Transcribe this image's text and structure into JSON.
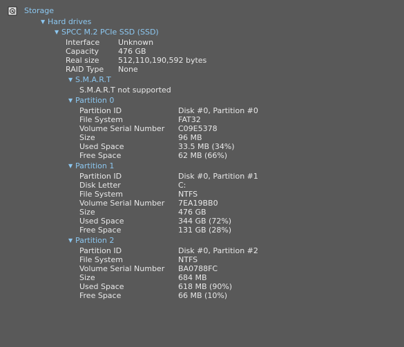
{
  "tree": {
    "root_label": "Storage",
    "hard_drives_label": "Hard drives",
    "drive_label": "SPCC M.2 PCIe SSD (SSD)",
    "drive_props": [
      {
        "key": "Interface",
        "value": "Unknown"
      },
      {
        "key": "Capacity",
        "value": "476 GB"
      },
      {
        "key": "Real size",
        "value": "512,110,190,592 bytes"
      },
      {
        "key": "RAID Type",
        "value": "None"
      }
    ],
    "smart_label": "S.M.A.R.T",
    "smart_status": "S.M.A.R.T not supported",
    "partitions": [
      {
        "label": "Partition 0",
        "props": [
          {
            "key": "Partition ID",
            "value": "Disk #0, Partition #0"
          },
          {
            "key": "File System",
            "value": "FAT32"
          },
          {
            "key": "Volume Serial Number",
            "value": "C09E5378"
          },
          {
            "key": "Size",
            "value": "96 MB"
          },
          {
            "key": "Used Space",
            "value": "33.5 MB (34%)"
          },
          {
            "key": "Free Space",
            "value": "62 MB (66%)"
          }
        ]
      },
      {
        "label": "Partition 1",
        "props": [
          {
            "key": "Partition ID",
            "value": "Disk #0, Partition #1"
          },
          {
            "key": "Disk Letter",
            "value": "C:"
          },
          {
            "key": "File System",
            "value": "NTFS"
          },
          {
            "key": "Volume Serial Number",
            "value": "7EA19BB0"
          },
          {
            "key": "Size",
            "value": "476 GB"
          },
          {
            "key": "Used Space",
            "value": "344 GB (72%)"
          },
          {
            "key": "Free Space",
            "value": "131 GB (28%)"
          }
        ]
      },
      {
        "label": "Partition 2",
        "props": [
          {
            "key": "Partition ID",
            "value": "Disk #0, Partition #2"
          },
          {
            "key": "File System",
            "value": "NTFS"
          },
          {
            "key": "Volume Serial Number",
            "value": "BA0788FC"
          },
          {
            "key": "Size",
            "value": "684 MB"
          },
          {
            "key": "Used Space",
            "value": "618 MB (90%)"
          },
          {
            "key": "Free Space",
            "value": "66 MB (10%)"
          }
        ]
      }
    ]
  },
  "colors": {
    "background": "#595959",
    "header_text": "#8cc7f0",
    "body_text": "#e8e8e8"
  },
  "icons": {
    "root": "hard-drive-icon",
    "expand": "caret-down-icon"
  }
}
